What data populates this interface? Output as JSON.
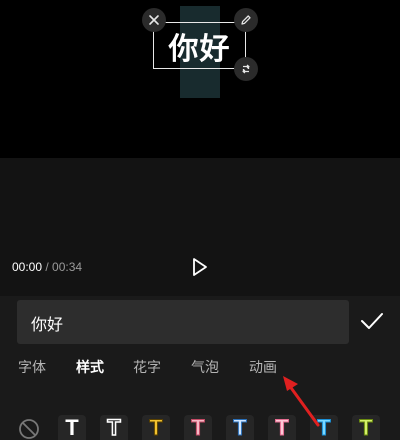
{
  "preview": {
    "overlay_text": "你好",
    "handles": [
      "close-icon",
      "edit-pencil-icon",
      "rotate-scale-icon"
    ]
  },
  "player": {
    "current_time": "00:00",
    "separator": " / ",
    "total_time": "00:34",
    "play_icon": "play-icon"
  },
  "text_input": {
    "value": "你好",
    "confirm_icon": "checkmark-icon"
  },
  "tabs": [
    {
      "label": "字体",
      "active": false
    },
    {
      "label": "样式",
      "active": true
    },
    {
      "label": "花字",
      "active": false
    },
    {
      "label": "气泡",
      "active": false
    },
    {
      "label": "动画",
      "active": false
    }
  ],
  "style_presets": {
    "none_icon": "no-style-icon",
    "tiles": [
      "T",
      "T",
      "T",
      "T",
      "T",
      "T",
      "T",
      "T"
    ]
  },
  "colors": {
    "background": "#000000",
    "panel": "#1a1a1a",
    "input": "#2d2d2d",
    "annotation_arrow": "#e02020"
  }
}
